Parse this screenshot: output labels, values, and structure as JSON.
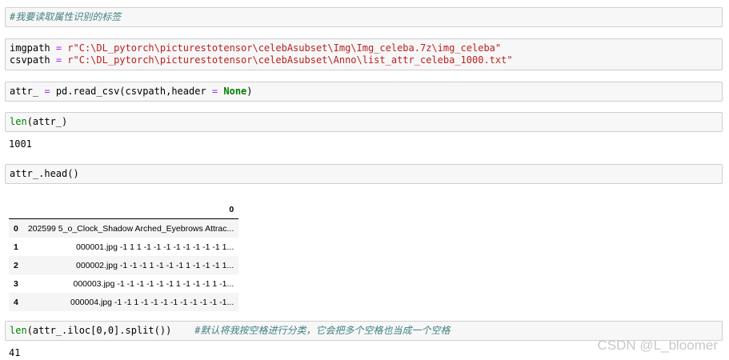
{
  "cells": {
    "c1": {
      "comment": "#我要读取属性识别的标签"
    },
    "c2": {
      "line1": {
        "var": "imgpath",
        "op": "=",
        "str": "r\"C:\\DL_pytorch\\picturestotensor\\celebAsubset\\Img\\Img_celeba.7z\\img_celeba\""
      },
      "line2": {
        "var": "csvpath",
        "op": "=",
        "str": "r\"C:\\DL_pytorch\\picturestotensor\\celebAsubset\\Anno\\list_attr_celeba_1000.txt\""
      }
    },
    "c3": {
      "pre": "attr_",
      "op": "=",
      "mid": "pd.read_csv(csvpath,header",
      "op2": "=",
      "kw": "None",
      "post": ")"
    },
    "c4": {
      "fn": "len",
      "rest": "(attr_)",
      "output": "1001"
    },
    "c5": {
      "code": "attr_.head()"
    },
    "c6": {
      "fn": "len",
      "rest": "(attr_.iloc[0,0].split())",
      "comment": "#默认将我按空格进行分类，它会把多个空格也当成一个空格",
      "output": "41"
    }
  },
  "dataframe": {
    "header": [
      "",
      "0"
    ],
    "rows": [
      {
        "index": "0",
        "value": "202599 5_o_Clock_Shadow Arched_Eyebrows Attrac..."
      },
      {
        "index": "1",
        "value": "000001.jpg -1 1 1 -1 -1 -1 -1 -1 -1 -1 -1 1..."
      },
      {
        "index": "2",
        "value": "000002.jpg -1 -1 -1 1 -1 -1 -1 1 -1 -1 -1 1..."
      },
      {
        "index": "3",
        "value": "000003.jpg -1 -1 -1 -1 -1 -1 1 -1 -1 -1 1 -1..."
      },
      {
        "index": "4",
        "value": "000004.jpg -1 -1 1 -1 -1 -1 -1 -1 -1 -1 -1 -1..."
      }
    ]
  },
  "watermark": "CSDN @L_bloomer"
}
